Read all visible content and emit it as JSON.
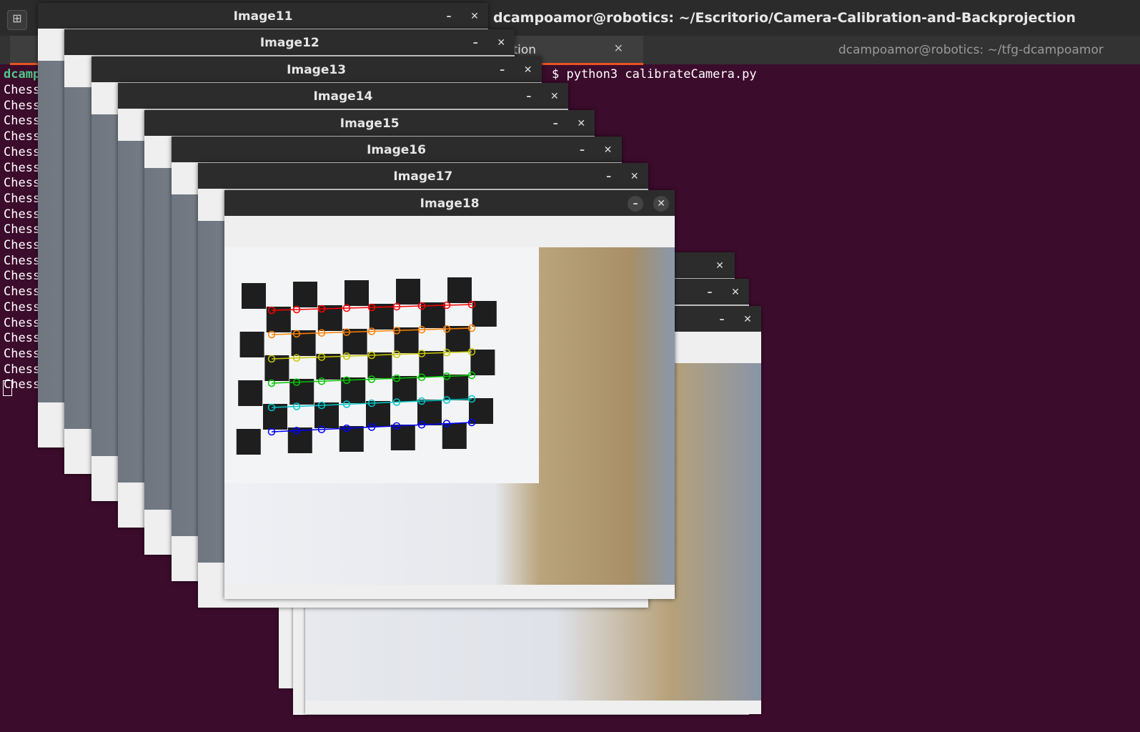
{
  "terminal": {
    "title": "dcampoamor@robotics: ~/Escritorio/Camera-Calibration-and-Backprojection",
    "tab1_label": "…ection",
    "tab2_label": "dcampoamor@robotics: ~/tfg-dcampoamor",
    "prompt_partial": "dcamp",
    "command": "$ python3 calibrateCamera.py",
    "output_lines": [
      "Chess",
      "Chess",
      "Chess",
      "Chess",
      "Chess",
      "Chess",
      "Chess",
      "Chess",
      "Chess",
      "Chess",
      "Chess",
      "Chess",
      "Chess",
      "Chess",
      "Chess",
      "Chess",
      "Chess",
      "Chess",
      "Chess",
      "Chess"
    ]
  },
  "windows": [
    {
      "title": "Image11"
    },
    {
      "title": "Image12"
    },
    {
      "title": "Image13"
    },
    {
      "title": "Image14"
    },
    {
      "title": "Image15"
    },
    {
      "title": "Image16"
    },
    {
      "title": "Image17"
    },
    {
      "title": "Image18"
    }
  ],
  "window_controls": {
    "minimize": "–",
    "close": "✕"
  },
  "icons": {
    "new_tab": "new-tab-icon",
    "minimize": "minimize-icon",
    "close": "close-icon"
  },
  "colors": {
    "terminal_bg": "#3c0c2c",
    "accent_tab": "#e95420",
    "prompt_green": "#4fc88a",
    "titlebar": "#2c2c2c"
  }
}
